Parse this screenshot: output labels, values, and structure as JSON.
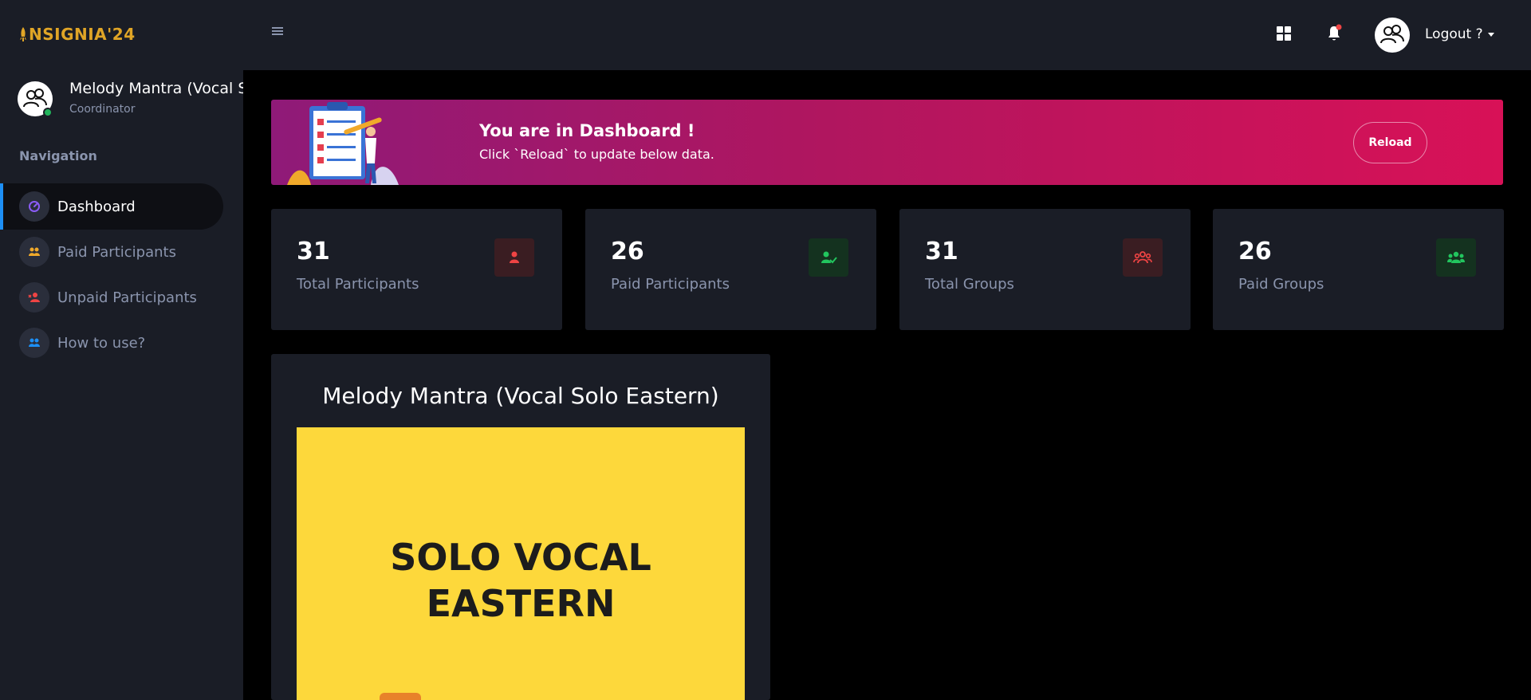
{
  "app": {
    "logo_text": "NSIGNIA'24"
  },
  "profile": {
    "name": "Melody Mantra (Vocal Solo Eastern)",
    "role": "Coordinator"
  },
  "nav": {
    "heading": "Navigation",
    "items": [
      {
        "label": "Dashboard",
        "icon": "gauge-icon",
        "active": true,
        "icon_color": "#8b5cf6"
      },
      {
        "label": "Paid Participants",
        "icon": "users-icon",
        "active": false,
        "icon_color": "#f0a92a"
      },
      {
        "label": "Unpaid Participants",
        "icon": "user-x-icon",
        "active": false,
        "icon_color": "#ef4444"
      },
      {
        "label": "How to use?",
        "icon": "users-icon",
        "active": false,
        "icon_color": "#1d8ff5"
      }
    ]
  },
  "header": {
    "menu_icon": "hamburger-icon",
    "apps_icon": "grid-icon",
    "notification_icon": "bell-icon",
    "user_menu_label": "Logout ?"
  },
  "banner": {
    "title": "You are in Dashboard !",
    "subtitle": "Click `Reload` to update below data.",
    "button_label": "Reload"
  },
  "stats": [
    {
      "value": "31",
      "label": "Total Participants",
      "icon": "user-icon",
      "color": "#ef4444",
      "bg": "#3a1d22"
    },
    {
      "value": "26",
      "label": "Paid Participants",
      "icon": "user-check-icon",
      "color": "#22c55e",
      "bg": "#14321f"
    },
    {
      "value": "31",
      "label": "Total Groups",
      "icon": "group-icon",
      "color": "#ef4444",
      "bg": "#3a1d22"
    },
    {
      "value": "26",
      "label": "Paid Groups",
      "icon": "group-icon",
      "color": "#22c55e",
      "bg": "#14321f"
    }
  ],
  "event": {
    "title": "Melody Mantra (Vocal Solo Eastern)",
    "poster_line1": "SOLO VOCAL",
    "poster_line2": "EASTERN"
  },
  "colors": {
    "sidebar_bg": "#1a1d26",
    "page_bg": "#000000",
    "accent_blue": "#1d8ff5",
    "banner_start": "#8f1a78",
    "banner_end": "#d81157",
    "poster_yellow": "#fdd83b",
    "logo_gold": "#e0a526"
  }
}
